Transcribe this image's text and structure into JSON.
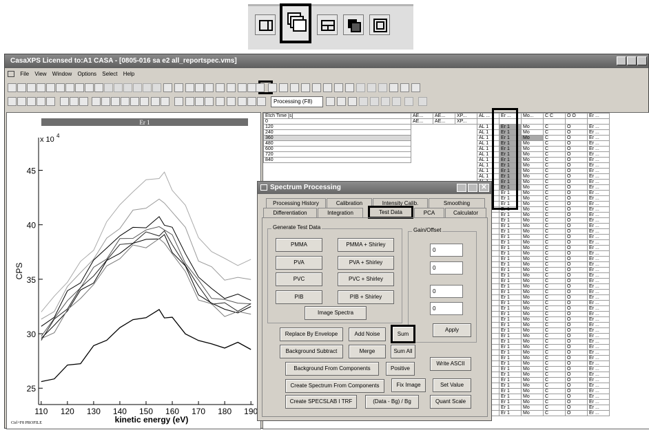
{
  "window": {
    "title": "CasaXPS Licensed to:A1 CASA - [0805-016 sa e2 all_reportspec.vms]"
  },
  "menu": [
    "File",
    "View",
    "Window",
    "Options",
    "Select",
    "Help"
  ],
  "toolbar": {
    "processing_label": "Processing (F8)"
  },
  "plot": {
    "title": "Er 1",
    "y_multiplier": "x 10",
    "y_exponent": "4",
    "ylabel": "CPS",
    "xlabel": "kinetic energy (eV)",
    "yticks": [
      "45",
      "40",
      "35",
      "30",
      "25"
    ],
    "xticks": [
      "110",
      "120",
      "130",
      "140",
      "150",
      "160",
      "170",
      "180",
      "190"
    ],
    "footer": "Ctrl+F8 PROFILE"
  },
  "chart_data": {
    "type": "line",
    "xlabel": "kinetic energy (eV)",
    "ylabel": "CPS",
    "xlim": [
      109,
      191
    ],
    "ylim": [
      23.5,
      48
    ],
    "y_scale_label": "x 10^4",
    "series": [
      {
        "x": [
          110,
          115,
          120,
          125,
          130,
          135,
          140,
          145,
          150,
          155,
          157,
          160,
          165,
          170,
          175,
          180,
          185,
          190
        ],
        "values": [
          32.0,
          33.3,
          35.0,
          36.3,
          38.0,
          40.0,
          42.0,
          43.0,
          44.0,
          44.5,
          44.5,
          43.5,
          41.5,
          39.0,
          37.5,
          36.8,
          36.5,
          36.5
        ]
      },
      {
        "x": [
          110,
          115,
          120,
          125,
          130,
          135,
          140,
          145,
          150,
          155,
          157,
          160,
          165,
          170,
          175,
          180,
          185,
          190
        ],
        "values": [
          31.0,
          32.3,
          34.2,
          35.6,
          37.0,
          38.5,
          40.0,
          41.0,
          41.8,
          42.2,
          42.0,
          41.3,
          39.5,
          37.0,
          35.8,
          35.2,
          35.0,
          35.0
        ]
      },
      {
        "x": [
          110,
          115,
          120,
          125,
          130,
          135,
          140,
          145,
          150,
          155,
          157,
          160,
          165,
          170,
          175,
          180,
          185,
          190
        ],
        "values": [
          30.5,
          31.8,
          33.6,
          35.0,
          36.5,
          38.0,
          39.0,
          39.6,
          40.0,
          40.4,
          40.3,
          39.5,
          37.5,
          35.2,
          34.0,
          33.5,
          33.3,
          33.4
        ]
      },
      {
        "x": [
          110,
          115,
          120,
          125,
          130,
          135,
          140,
          145,
          150,
          155,
          157,
          160,
          165,
          170,
          175,
          180,
          185,
          190
        ],
        "values": [
          30.0,
          31.3,
          33.0,
          34.4,
          35.8,
          37.2,
          38.4,
          39.0,
          39.4,
          39.8,
          39.7,
          38.8,
          36.8,
          34.6,
          33.5,
          33.0,
          32.8,
          32.9
        ]
      },
      {
        "x": [
          110,
          115,
          120,
          125,
          130,
          135,
          140,
          145,
          150,
          155,
          157,
          160,
          165,
          170,
          175,
          180,
          185,
          190
        ],
        "values": [
          29.7,
          31.0,
          32.6,
          34.0,
          35.4,
          36.8,
          38.0,
          38.6,
          39.0,
          39.3,
          39.2,
          38.3,
          36.3,
          34.2,
          33.0,
          32.5,
          32.4,
          32.5
        ]
      },
      {
        "x": [
          110,
          115,
          120,
          125,
          130,
          135,
          140,
          145,
          150,
          155,
          157,
          160,
          165,
          170,
          175,
          180,
          185,
          190
        ],
        "values": [
          29.5,
          30.7,
          32.3,
          33.7,
          35.0,
          36.4,
          37.6,
          38.2,
          38.6,
          38.9,
          38.8,
          37.8,
          35.9,
          33.8,
          32.7,
          32.2,
          32.1,
          32.2
        ]
      },
      {
        "x": [
          110,
          115,
          120,
          125,
          130,
          135,
          140,
          145,
          150,
          155,
          157,
          160,
          165,
          170,
          175,
          180,
          185,
          190
        ],
        "values": [
          29.2,
          30.4,
          32.0,
          33.3,
          34.6,
          36.0,
          37.2,
          37.8,
          38.2,
          38.5,
          38.4,
          37.4,
          35.5,
          33.4,
          32.4,
          31.9,
          31.8,
          31.9
        ]
      },
      {
        "x": [
          110,
          115,
          120,
          125,
          130,
          135,
          140,
          145,
          150,
          155,
          157,
          160,
          165,
          170,
          175,
          180,
          185,
          190
        ],
        "values": [
          25.5,
          26.1,
          26.8,
          27.6,
          28.6,
          29.6,
          30.5,
          31.2,
          31.7,
          31.9,
          31.8,
          31.2,
          30.2,
          29.3,
          29.0,
          28.9,
          28.9,
          28.9
        ]
      }
    ]
  },
  "dialog": {
    "title": "Spectrum Processing",
    "tabs_row1": [
      "Processing History",
      "Calibration",
      "Intensity Calib.",
      "Smoothing"
    ],
    "tabs_row2": [
      "Differentiation",
      "Integration",
      "Test Data",
      "PCA",
      "Calculator"
    ],
    "group_test": "Generate Test Data",
    "group_gain": "Gain/Offset",
    "buttons": {
      "pmma": "PMMA",
      "pmma_shirley": "PMMA + Shirley",
      "pva": "PVA",
      "pva_shirley": "PVA + Shirley",
      "pvc": "PVC",
      "pvc_shirley": "PVC + Shirley",
      "pib": "PIB",
      "pib_shirley": "PIB + Shirley",
      "image_spectra": "Image Spectra",
      "apply": "Apply",
      "replace_envelope": "Replace By Envelope",
      "add_noise": "Add Noise",
      "sum": "Sum",
      "background_subtract": "Background Subtract",
      "merge": "Merge",
      "sum_all": "Sum All",
      "bg_from_components": "Background From Components",
      "positive": "Positive",
      "write_ascii": "Write ASCII",
      "create_spectrum": "Create Spectrum From Components",
      "fix_image": "Fix Image",
      "set_value": "Set Value",
      "create_specslab": "Create SPECSLAB I TRF",
      "data_bg": "(Data - Bg) / Bg",
      "quant_scale": "Quant Scale"
    },
    "inputs": [
      "0",
      "0",
      "0",
      "0"
    ]
  },
  "table": {
    "header": [
      "Etch Time [s]",
      "AE...",
      "AE...",
      "XP...",
      "AL ...",
      "Er ...",
      "Mo...",
      "C C",
      "O O",
      "Er ..."
    ],
    "row0": [
      "0",
      "AE...",
      "AE...",
      "XP..."
    ],
    "etch_times": [
      "120",
      "240",
      "360",
      "480",
      "600",
      "720",
      "840"
    ],
    "row_al": "AL 1",
    "row_er": "Er 1",
    "row_mo": "Mo",
    "row_c": "C",
    "row_o": "O",
    "row_er2": "Er ..."
  }
}
